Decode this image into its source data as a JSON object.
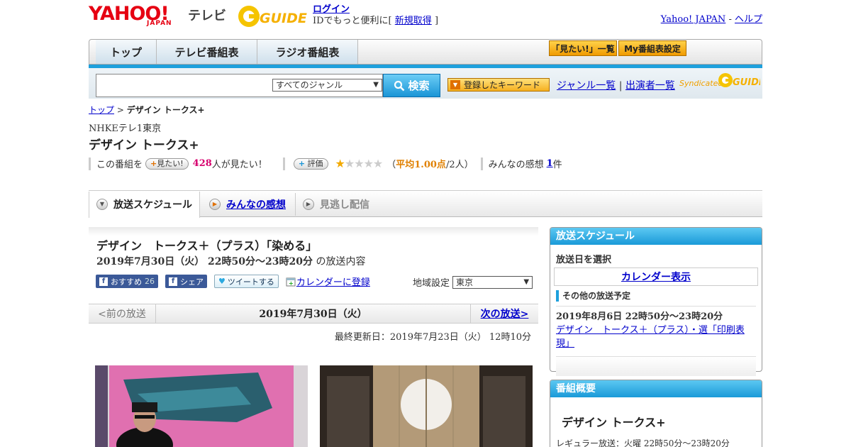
{
  "header": {
    "logo_yahoo": "YAHOO!",
    "logo_japan": "JAPAN",
    "logo_tv": "テレビ",
    "logo_gguide": "GUIDE",
    "login_label": "ログイン",
    "login_note": "IDでもっと便利に[",
    "signup_label": "新規取得",
    "signup_close": "]",
    "yahoo_japan_link": "Yahoo! JAPAN",
    "separator": "-",
    "help_link": "ヘルプ"
  },
  "nav": {
    "tabs": [
      "トップ",
      "テレビ番組表",
      "ラジオ番組表"
    ],
    "mitai_list": "「見たい!」一覧",
    "my_schedule": "My番組表設定"
  },
  "search": {
    "genre_selected": "すべてのジャンル",
    "search_button": "検索",
    "keyword_button": "登録したキーワード",
    "genre_list_link": "ジャンル一覧",
    "pipe": "|",
    "performer_list_link": "出演者一覧",
    "syndicated": "Syndicated"
  },
  "breadcrumb": {
    "top": "トップ",
    "sep": ">",
    "current": "デザイン トークス+"
  },
  "program": {
    "channel": "NHKEテレ1東京",
    "title": "デザイン トークス+",
    "want_prefix": "この番組を",
    "want_button": "見たい!",
    "want_count": "428",
    "want_suffix": "人が見たい！",
    "rating_button": "評価",
    "stars_total": 5,
    "stars_filled": 1,
    "avg_open": "（",
    "avg_label": "平均1.00点",
    "avg_people": "/2人）",
    "impressions_label": "みんなの感想",
    "impressions_count": "1",
    "impressions_suffix": "件"
  },
  "tabs": {
    "schedule": "放送スケジュール",
    "impressions": "みんなの感想",
    "vod": "見逃し配信"
  },
  "episode": {
    "title": "デザイン　トークス＋（プラス）「染める」",
    "date_time": "2019年7月30日（火） 22時50分～23時20分",
    "date_suffix": "の放送内容",
    "fb_recommend": "おすすめ",
    "fb_count": "26",
    "fb_share": "シェア",
    "tweet": "ツイートする",
    "calendar_register": "カレンダーに登録",
    "region_label": "地域設定",
    "region_selected": "東京"
  },
  "pager": {
    "prev": "<前の放送",
    "current": "2019年7月30日（火）",
    "next": "次の放送>"
  },
  "updated": "最終更新日：2019年7月23日（火） 12時10分",
  "sidebar": {
    "schedule_head": "放送スケジュール",
    "select_date": "放送日を選択",
    "calendar_button": "カレンダー表示",
    "other_head": "その他の放送予定",
    "other_date": "2019年8月6日 22時50分～23時20分",
    "other_title": "デザイン　トークス＋（プラス）・選「印刷表現」",
    "overview_head": "番組概要",
    "overview_title": "デザイン トークス+",
    "overview_regular": "レギュラー放送：火曜 22時50分～23時20分"
  },
  "colors": {
    "accent_blue": "#1ea0dc",
    "yahoo_red": "#e60012",
    "rating_orange": "#e08000",
    "want_pink": "#d6006d"
  }
}
